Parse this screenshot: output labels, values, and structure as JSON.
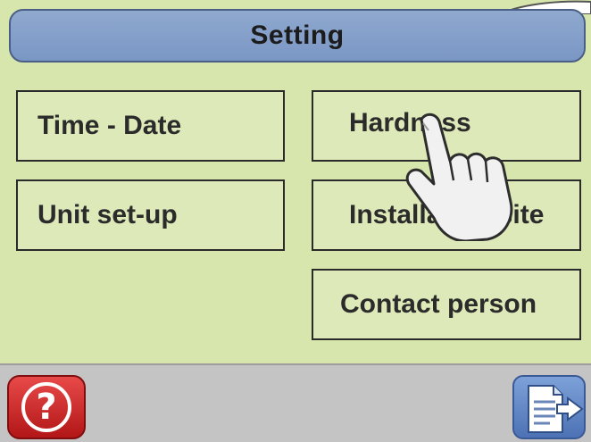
{
  "header": {
    "title": "Setting"
  },
  "menu": {
    "time_date": "Time - Date",
    "unit_setup": "Unit set-up",
    "hardness": "Hardness",
    "installation_site": "Installation site",
    "contact_person": "Contact person"
  },
  "footer": {
    "help_symbol": "?"
  },
  "icons": {
    "help": "help-question-icon",
    "exit": "exit-document-arrow-icon",
    "pointer": "hand-pointer-icon"
  },
  "colors": {
    "screen_bg": "#d7e6ad",
    "title_bar": "#8fa9cf",
    "help_red": "#d42b2b",
    "exit_blue": "#5f85c6",
    "bottom_bar": "#c4c4c4"
  }
}
